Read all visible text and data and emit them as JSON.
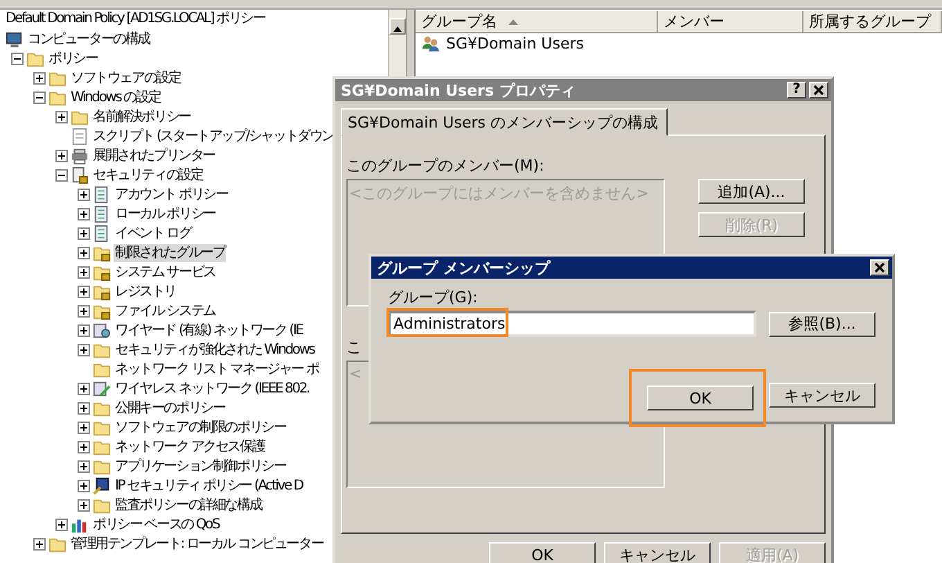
{
  "tree": {
    "title": "Default Domain Policy [AD1SG.LOCAL] ポリシー",
    "items": [
      {
        "label": "コンピューターの構成",
        "kind": "computer",
        "expandable": false,
        "selected": false,
        "children": [
          {
            "label": "ポリシー",
            "kind": "folder",
            "expandable": true,
            "expanded": true,
            "selected": false,
            "children": [
              {
                "label": "ソフトウェアの設定",
                "kind": "folder",
                "expandable": true,
                "expanded": false,
                "selected": false
              },
              {
                "label": "Windows の設定",
                "kind": "folder",
                "expandable": true,
                "expanded": true,
                "selected": false,
                "children": [
                  {
                    "label": "名前解決ポリシー",
                    "kind": "folder",
                    "expandable": true,
                    "expanded": false,
                    "selected": false
                  },
                  {
                    "label": "スクリプト (スタートアップ/シャットダウン",
                    "kind": "script",
                    "expandable": false,
                    "selected": false
                  },
                  {
                    "label": "展開されたプリンター",
                    "kind": "printer",
                    "expandable": true,
                    "expanded": false,
                    "selected": false
                  },
                  {
                    "label": "セキュリティの設定",
                    "kind": "secure",
                    "expandable": true,
                    "expanded": true,
                    "selected": false,
                    "children": [
                      {
                        "label": "アカウント ポリシー",
                        "kind": "policy",
                        "expandable": true,
                        "expanded": false,
                        "selected": false
                      },
                      {
                        "label": "ローカル ポリシー",
                        "kind": "policy",
                        "expandable": true,
                        "expanded": false,
                        "selected": false
                      },
                      {
                        "label": "イベント ログ",
                        "kind": "policy",
                        "expandable": true,
                        "expanded": false,
                        "selected": false
                      },
                      {
                        "label": "制限されたグループ",
                        "kind": "lockfolder",
                        "expandable": true,
                        "expanded": false,
                        "selected": true
                      },
                      {
                        "label": "システム サービス",
                        "kind": "lockfolder",
                        "expandable": true,
                        "expanded": false,
                        "selected": false
                      },
                      {
                        "label": "レジストリ",
                        "kind": "lockfolder",
                        "expandable": true,
                        "expanded": false,
                        "selected": false
                      },
                      {
                        "label": "ファイル システム",
                        "kind": "lockfolder",
                        "expandable": true,
                        "expanded": false,
                        "selected": false
                      },
                      {
                        "label": "ワイヤード (有線) ネットワーク (IE",
                        "kind": "network",
                        "expandable": true,
                        "expanded": false,
                        "selected": false
                      },
                      {
                        "label": "セキュリティが強化された Windows",
                        "kind": "folder",
                        "expandable": true,
                        "expanded": false,
                        "selected": false
                      },
                      {
                        "label": "ネットワーク リスト マネージャー ポ",
                        "kind": "folder",
                        "expandable": false,
                        "selected": false
                      },
                      {
                        "label": "ワイヤレス ネットワーク (IEEE 802.",
                        "kind": "wireless",
                        "expandable": true,
                        "expanded": false,
                        "selected": false
                      },
                      {
                        "label": "公開キーのポリシー",
                        "kind": "folder",
                        "expandable": true,
                        "expanded": false,
                        "selected": false
                      },
                      {
                        "label": "ソフトウェアの制限のポリシー",
                        "kind": "folder",
                        "expandable": true,
                        "expanded": false,
                        "selected": false
                      },
                      {
                        "label": "ネットワーク アクセス保護",
                        "kind": "folder",
                        "expandable": true,
                        "expanded": false,
                        "selected": false
                      },
                      {
                        "label": "アプリケーション制御ポリシー",
                        "kind": "folder",
                        "expandable": true,
                        "expanded": false,
                        "selected": false
                      },
                      {
                        "label": "IP セキュリティ ポリシー (Active D",
                        "kind": "ipsec",
                        "expandable": true,
                        "expanded": false,
                        "selected": false
                      },
                      {
                        "label": "監査ポリシーの詳細な構成",
                        "kind": "folder",
                        "expandable": true,
                        "expanded": false,
                        "selected": false
                      }
                    ]
                  },
                  {
                    "label": "ポリシー ベースの QoS",
                    "kind": "chart",
                    "expandable": true,
                    "expanded": false,
                    "selected": false
                  }
                ]
              },
              {
                "label": "管理用テンプレート: ローカル コンピューター",
                "kind": "folder",
                "expandable": true,
                "expanded": false,
                "selected": false
              }
            ]
          }
        ]
      }
    ]
  },
  "list": {
    "columns": [
      {
        "label": "グループ名",
        "sorted": true
      },
      {
        "label": "メンバー",
        "sorted": false
      },
      {
        "label": "所属するグループ",
        "sorted": false
      }
    ],
    "rows": [
      {
        "name": "SG¥Domain Users"
      }
    ]
  },
  "properties_dialog": {
    "title": "SG¥Domain Users プロパティ",
    "active": false,
    "help": "?",
    "tabs": [
      {
        "label": "SG¥Domain Users のメンバーシップの構成",
        "selected": true
      }
    ],
    "members_label": "このグループのメンバー(M):",
    "members_placeholder": "<このグループにはメンバーを含めません>",
    "side_buttons": [
      {
        "label": "追加(A)...",
        "disabled": false
      },
      {
        "label": "削除(R)",
        "disabled": true
      }
    ],
    "member_of_label": "こ",
    "member_of_placeholder": "<",
    "buttons": [
      {
        "label": "OK",
        "disabled": false
      },
      {
        "label": "キャンセル",
        "disabled": false
      },
      {
        "label": "適用(A)",
        "disabled": true
      }
    ]
  },
  "membership_dialog": {
    "title": "グループ メンバーシップ",
    "active": true,
    "field_label": "グループ(G):",
    "field_value": "Administrators",
    "field_highlighted": true,
    "browse_button": "参照(B)...",
    "buttons": [
      {
        "label": "OK",
        "highlighted": true
      },
      {
        "label": "キャンセル",
        "highlighted": false
      }
    ]
  }
}
